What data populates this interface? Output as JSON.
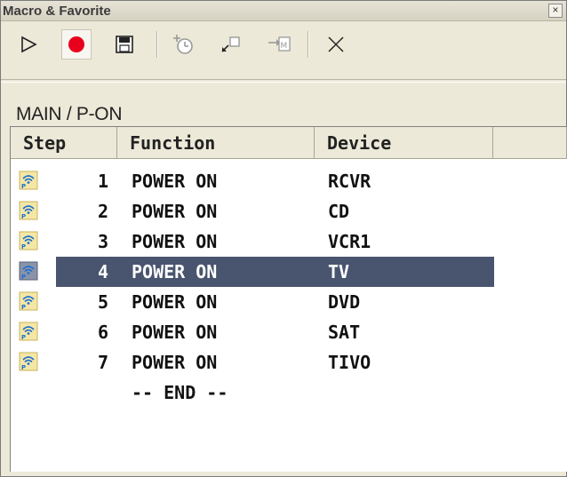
{
  "window": {
    "title": "Macro & Favorite",
    "close_glyph": "×"
  },
  "toolbar": {
    "buttons": [
      {
        "name": "play-icon",
        "label": "Play"
      },
      {
        "name": "record-icon",
        "label": "Record"
      },
      {
        "name": "save-icon",
        "label": "Save"
      },
      {
        "name": "add-timer-icon",
        "label": "Insert delay"
      },
      {
        "name": "move-icon",
        "label": "Move"
      },
      {
        "name": "insert-macro-icon",
        "label": "Insert macro"
      },
      {
        "name": "delete-icon",
        "label": "Delete"
      }
    ],
    "colors": {
      "record": "#e8001c"
    }
  },
  "path": "MAIN / P-ON",
  "table": {
    "columns": [
      "Step",
      "Function",
      "Device"
    ],
    "rows": [
      {
        "step": "1",
        "function": "POWER ON",
        "device": "RCVR"
      },
      {
        "step": "2",
        "function": "POWER ON",
        "device": "CD"
      },
      {
        "step": "3",
        "function": "POWER ON",
        "device": "VCR1"
      },
      {
        "step": "4",
        "function": "POWER ON",
        "device": "TV",
        "selected": true
      },
      {
        "step": "5",
        "function": "POWER ON",
        "device": "DVD"
      },
      {
        "step": "6",
        "function": "POWER ON",
        "device": "SAT"
      },
      {
        "step": "7",
        "function": "POWER ON",
        "device": "TIVO"
      }
    ],
    "end_marker": "-- END --",
    "selection_color": "#49546f"
  }
}
